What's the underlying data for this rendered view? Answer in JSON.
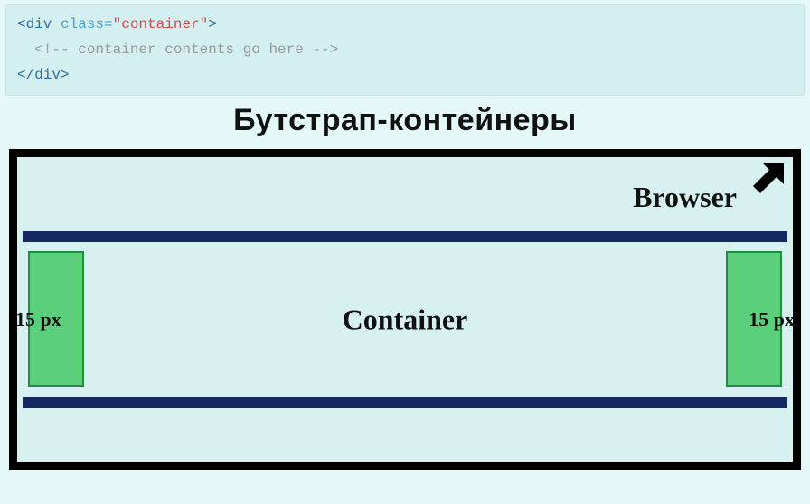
{
  "code": {
    "line1_open": "<div",
    "line1_attr_name": "class=",
    "line1_attr_val": "\"container\"",
    "line1_close": ">",
    "line2_comment": "<!-- container contents go here -->",
    "line3": "</div>"
  },
  "heading": "Бутстрап-контейнеры",
  "diagram": {
    "browser_label": "Browser",
    "container_label": "Container",
    "padding_left_label": "15 px",
    "padding_right_label": "15 px"
  }
}
